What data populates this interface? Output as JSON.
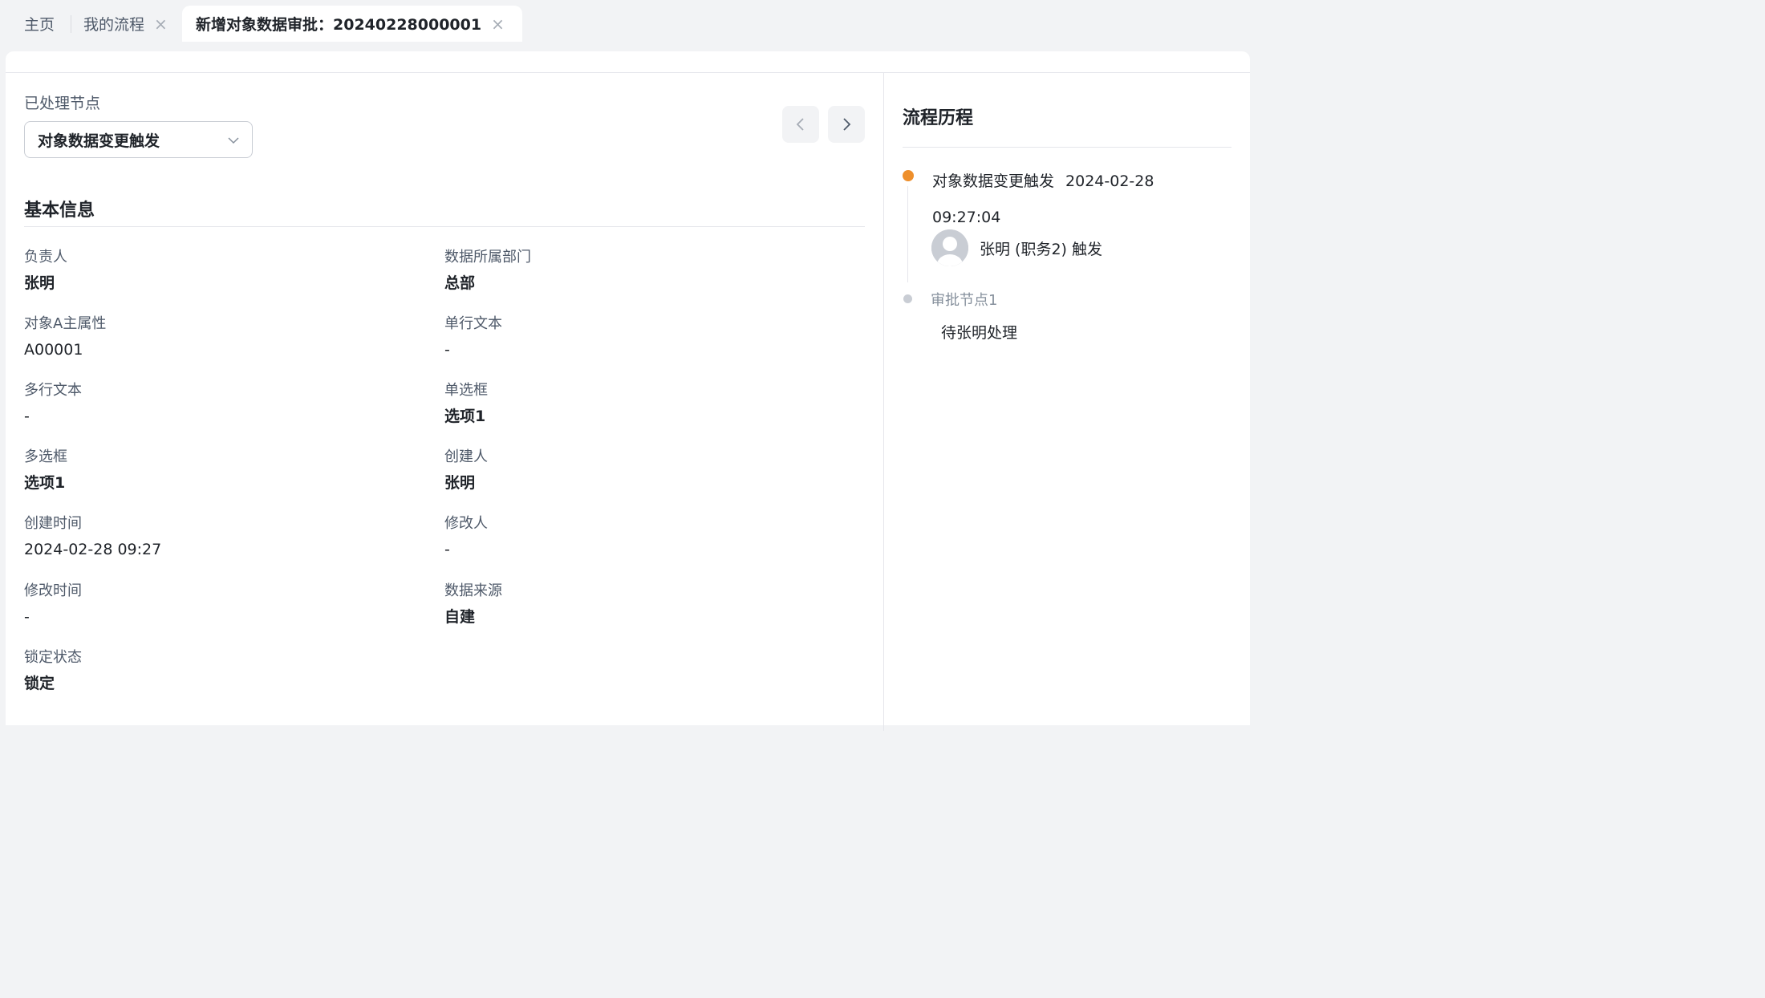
{
  "tabs": {
    "home": "主页",
    "my_flow": "我的流程",
    "active": "新增对象数据审批：20240228000001",
    "close_glyph": "×"
  },
  "processed_nodes": {
    "label": "已处理节点",
    "selected": "对象数据变更触发"
  },
  "basic_info": {
    "title": "基本信息",
    "fields": [
      {
        "label": "负责人",
        "value": "张明"
      },
      {
        "label": "数据所属部门",
        "value": "总部"
      },
      {
        "label": "对象A主属性",
        "value": "A00001"
      },
      {
        "label": "单行文本",
        "value": "-"
      },
      {
        "label": "多行文本",
        "value": "-"
      },
      {
        "label": "单选框",
        "value": "选项1"
      },
      {
        "label": "多选框",
        "value": "选项1"
      },
      {
        "label": "创建人",
        "value": "张明"
      },
      {
        "label": "创建时间",
        "value": "2024-02-28 09:27"
      },
      {
        "label": "修改人",
        "value": "-"
      },
      {
        "label": "修改时间",
        "value": "-"
      },
      {
        "label": "数据来源",
        "value": "自建"
      },
      {
        "label": "锁定状态",
        "value": "锁定"
      }
    ]
  },
  "history": {
    "title": "流程历程",
    "steps": [
      {
        "node": "对象数据变更触发",
        "time": "2024-02-28 09:27:04",
        "actor": "张明 (职务2) 触发",
        "status_color": "#ee8f2b"
      },
      {
        "node": "审批节点1",
        "pending": "待张明处理",
        "status_color": "#c9cdd4"
      }
    ]
  }
}
